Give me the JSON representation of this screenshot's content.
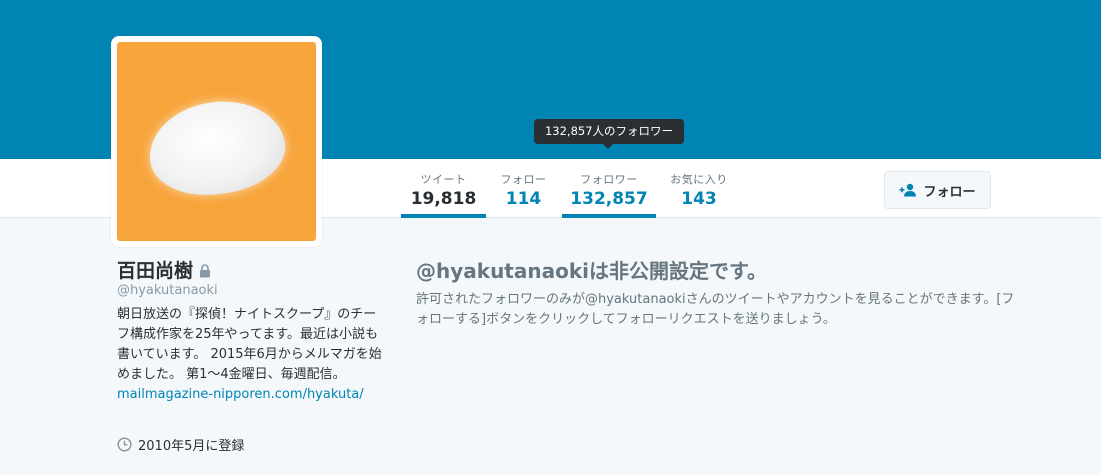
{
  "colors": {
    "banner": "#0084b4",
    "accent": "#0084b4",
    "avatar_bg": "#f7a53b",
    "tooltip_bg": "#292f33"
  },
  "tooltip": {
    "text": "132,857人のフォロワー"
  },
  "stats": [
    {
      "label": "ツイート",
      "value": "19,818"
    },
    {
      "label": "フォロー",
      "value": "114"
    },
    {
      "label": "フォロワー",
      "value": "132,857"
    },
    {
      "label": "お気に入り",
      "value": "143"
    }
  ],
  "follow_button": {
    "label": "フォロー",
    "icon": "add-user-icon"
  },
  "profile": {
    "name": "百田尚樹",
    "lock_icon": "lock-icon",
    "screen_name": "@hyakutanaoki",
    "bio_text": "朝日放送の『探偵！ナイトスクープ』のチーフ構成作家を25年やってます。最近は小説も書いています。 2015年6月からメルマガを始めました。 第1〜4金曜日、毎週配信。",
    "bio_link": "mailmagazine-nipporen.com/hyakuta/",
    "joined": "2010年5月に登録",
    "joined_icon": "clock-icon"
  },
  "protected": {
    "title": "@hyakutanaokiは非公開設定です。",
    "description": "許可されたフォロワーのみが@hyakutanaokiさんのツイートやアカウントを見ることができます。[フォローする]ボタンをクリックしてフォローリクエストを送りましょう。"
  }
}
